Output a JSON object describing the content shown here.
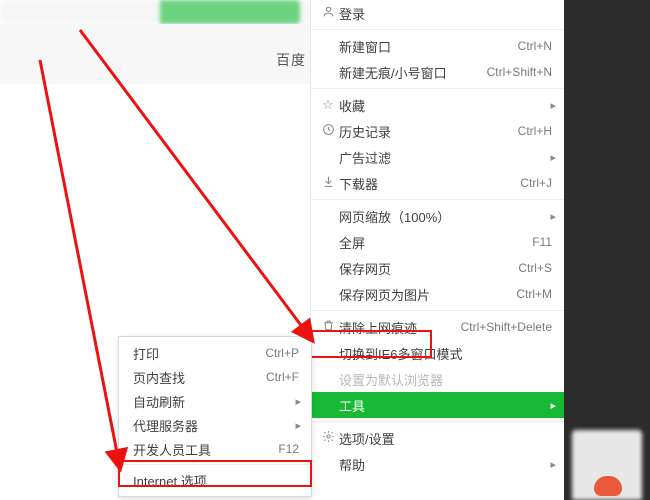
{
  "page": {
    "baidu_fragment": "百度"
  },
  "main_menu": {
    "login": {
      "label": "登录"
    },
    "new_window": {
      "label": "新建窗口",
      "shortcut": "Ctrl+N"
    },
    "new_private": {
      "label": "新建无痕/小号窗口",
      "shortcut": "Ctrl+Shift+N"
    },
    "favorites": {
      "label": "收藏"
    },
    "history": {
      "label": "历史记录",
      "shortcut": "Ctrl+H"
    },
    "ad_filter": {
      "label": "广告过滤"
    },
    "downloader": {
      "label": "下载器",
      "shortcut": "Ctrl+J"
    },
    "zoom": {
      "label": "网页缩放（100%）"
    },
    "fullscreen": {
      "label": "全屏",
      "shortcut": "F11"
    },
    "save_page": {
      "label": "保存网页",
      "shortcut": "Ctrl+S"
    },
    "save_as_image": {
      "label": "保存网页为图片",
      "shortcut": "Ctrl+M"
    },
    "clear_traces": {
      "label": "清除上网痕迹",
      "shortcut": "Ctrl+Shift+Delete"
    },
    "switch_ie6": {
      "label": "切换到IE6多窗口模式"
    },
    "set_default": {
      "label": "设置为默认浏览器"
    },
    "tools": {
      "label": "工具"
    },
    "options": {
      "label": "选项/设置"
    },
    "help": {
      "label": "帮助"
    }
  },
  "sub_menu": {
    "print": {
      "label": "打印",
      "shortcut": "Ctrl+P"
    },
    "find_in_page": {
      "label": "页内查找",
      "shortcut": "Ctrl+F"
    },
    "auto_refresh": {
      "label": "自动刷新"
    },
    "proxy": {
      "label": "代理服务器"
    },
    "dev_tools": {
      "label": "开发人员工具",
      "shortcut": "F12"
    },
    "internet_opts": {
      "label": "Internet 选项"
    }
  }
}
